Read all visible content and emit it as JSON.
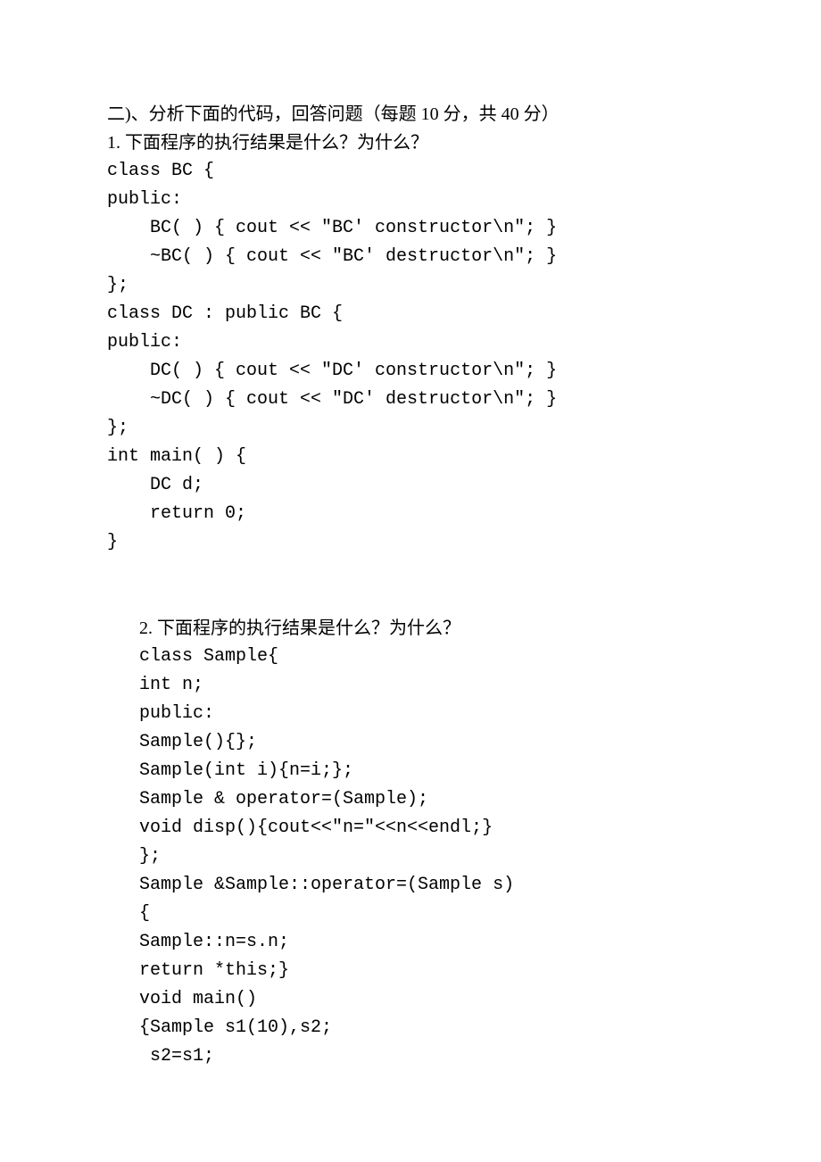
{
  "section_header": "二)、分析下面的代码，回答问题（每题 10 分，共 40 分）",
  "q1": {
    "prompt": "1. 下面程序的执行结果是什么？为什么？",
    "lines": [
      "class BC {",
      "public:",
      "    BC( ) { cout << \"BC' constructor\\n\"; }",
      "    ~BC( ) { cout << \"BC' destructor\\n\"; }",
      "};",
      "class DC : public BC {",
      "public:",
      "    DC( ) { cout << \"DC' constructor\\n\"; }",
      "    ~DC( ) { cout << \"DC' destructor\\n\"; }",
      "};",
      "int main( ) {",
      "    DC d;",
      "    return 0;",
      "}"
    ]
  },
  "q2": {
    "prompt": "2. 下面程序的执行结果是什么？为什么？",
    "lines": [
      "class Sample{",
      "int n;",
      "public:",
      "Sample(){};",
      "Sample(int i){n=i;};",
      "Sample & operator=(Sample);",
      "void disp(){cout<<\"n=\"<<n<<endl;}",
      "};",
      "Sample &Sample::operator=(Sample s)",
      "{",
      "Sample::n=s.n;",
      "return *this;}",
      "void main()",
      "{Sample s1(10),s2;",
      " s2=s1;"
    ]
  }
}
